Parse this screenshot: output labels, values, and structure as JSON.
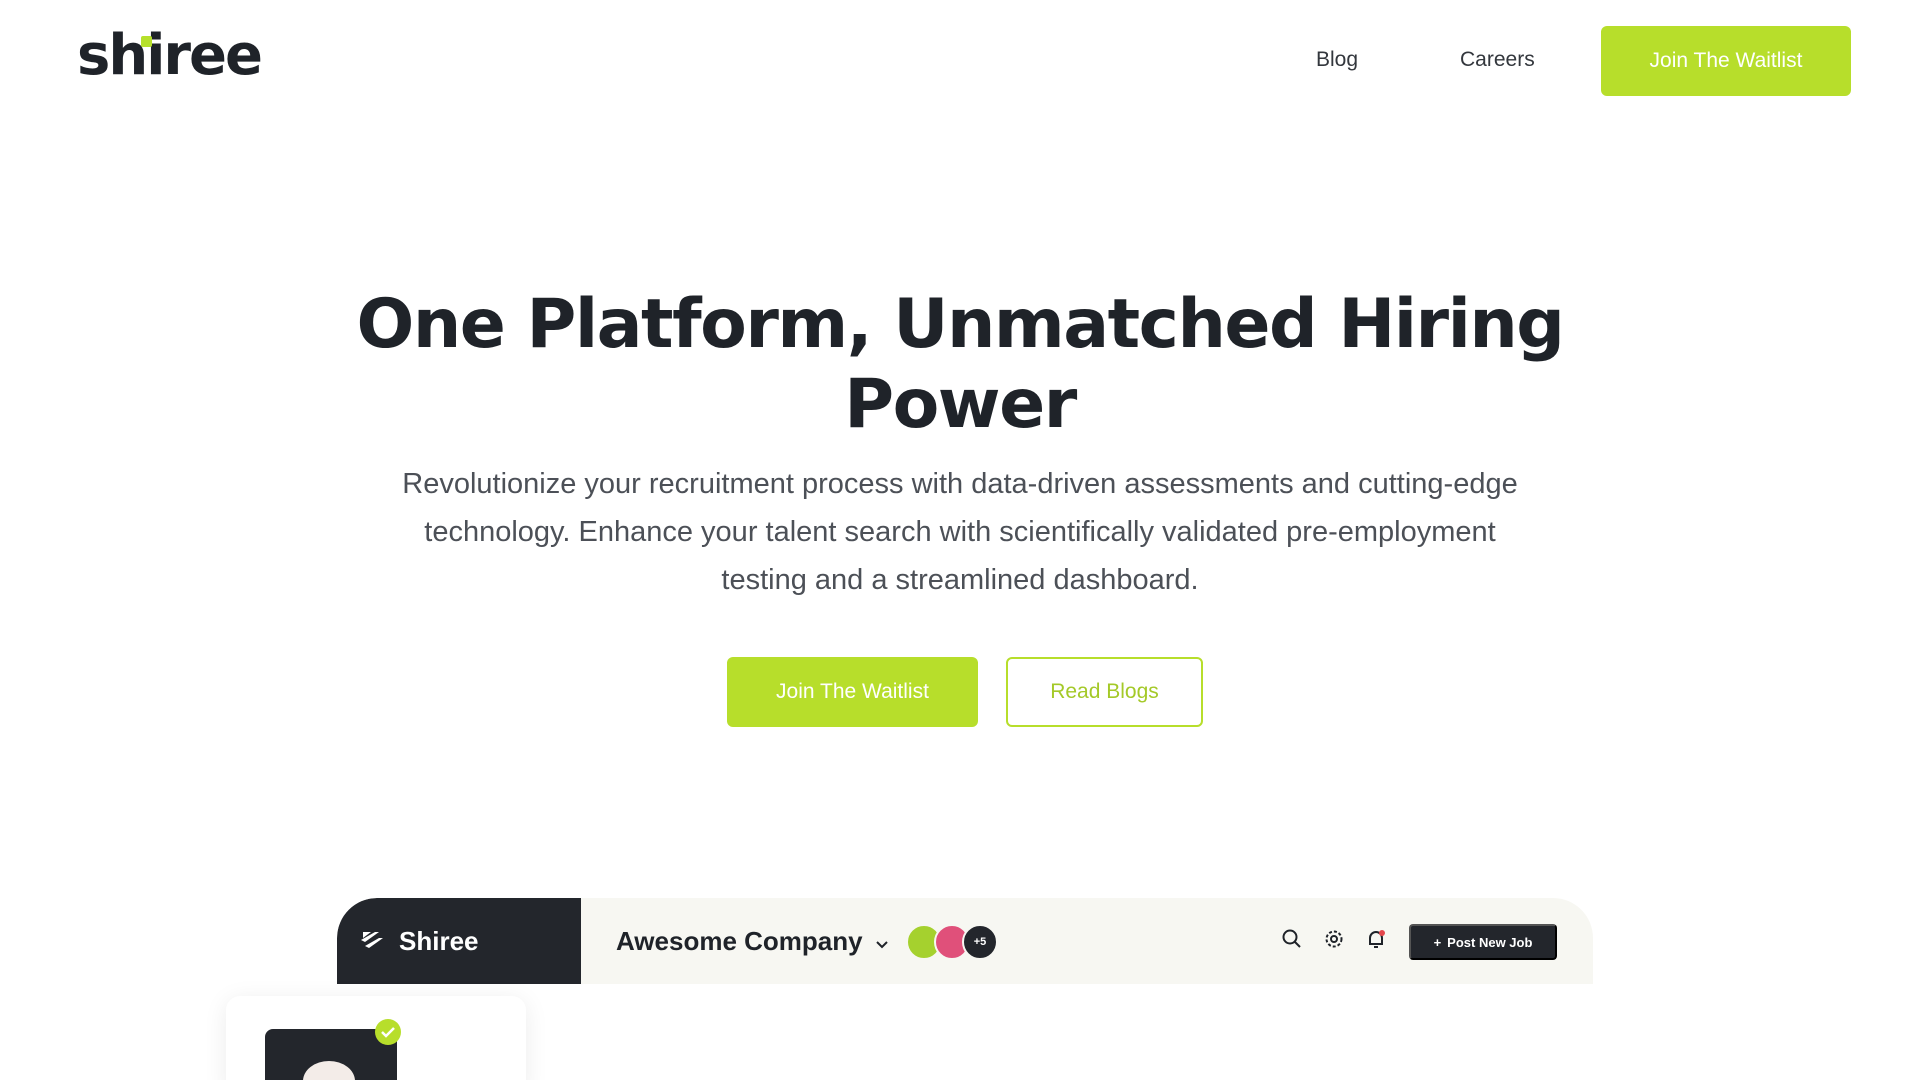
{
  "header": {
    "logo_text": "shiree",
    "nav": [
      {
        "label": "Blog"
      },
      {
        "label": "Careers"
      }
    ],
    "cta_label": "Join The Waitlist"
  },
  "hero": {
    "title": "One Platform, Unmatched Hiring Power",
    "subtitle": "Revolutionize your recruitment process with data-driven assessments and cutting-edge technology. Enhance your talent search with scientifically validated pre-employment testing and a streamlined dashboard.",
    "primary_cta": "Join The Waitlist",
    "secondary_cta": "Read Blogs"
  },
  "dashboard": {
    "brand": "Shiree",
    "company": "Awesome Company",
    "avatars_more": "+5",
    "post_job_label": "Post New Job",
    "icons": [
      "search-icon",
      "gear-icon",
      "bell-icon"
    ]
  },
  "colors": {
    "accent": "#b7de2b",
    "dark": "#23262c",
    "text": "#1f2329"
  }
}
